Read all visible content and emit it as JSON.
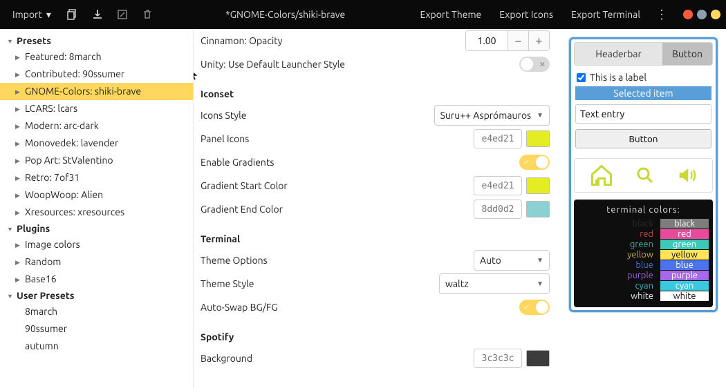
{
  "header": {
    "import_label": "Import",
    "title": "*GNOME-Colors/shiki-brave",
    "export_theme": "Export Theme",
    "export_icons": "Export Icons",
    "export_terminal": "Export Terminal",
    "dot_colors": [
      "#ff5a3c",
      "#8ca0b3",
      "#ffd75f"
    ]
  },
  "sidebar": {
    "groups": [
      {
        "title": "Presets",
        "items": [
          "Featured: 8march",
          "Contributed: 90ssumer",
          "GNOME-Colors: shiki-brave",
          "LCARS: lcars",
          "Modern: arc-dark",
          "Monovedek: lavender",
          "Pop Art: StValentino",
          "Retro: 7of31",
          "WoopWoop: Alien",
          "Xresources: xresources"
        ],
        "selected_index": 2
      },
      {
        "title": "Plugins",
        "items": [
          "Image colors",
          "Random",
          "Base16"
        ]
      },
      {
        "title": "User Presets",
        "items": [
          "8march",
          "90ssumer",
          "autumn"
        ],
        "leaf": true
      }
    ]
  },
  "main": {
    "cinnamon_opacity_label": "Cinnamon: Opacity",
    "cinnamon_opacity_value": "1.00",
    "unity_label": "Unity: Use Default Launcher Style",
    "iconset_h": "Iconset",
    "icons_style_label": "Icons Style",
    "icons_style_value": "Suru++ Asprómauros",
    "panel_icons_label": "Panel Icons",
    "panel_icons_hex": "e4ed21",
    "panel_icons_color": "#e4ed21",
    "enable_gradients_label": "Enable Gradients",
    "grad_start_label": "Gradient Start Color",
    "grad_start_hex": "e4ed21",
    "grad_start_color": "#e4ed21",
    "grad_end_label": "Gradient End Color",
    "grad_end_hex": "8dd0d2",
    "grad_end_color": "#8dd0d2",
    "terminal_h": "Terminal",
    "theme_options_label": "Theme Options",
    "theme_options_value": "Auto",
    "theme_style_label": "Theme Style",
    "theme_style_value": "waltz",
    "autoswap_label": "Auto-Swap BG/FG",
    "spotify_h": "Spotify",
    "bg_label": "Background",
    "bg_hex": "3c3c3c",
    "bg_color": "#3c3c3c"
  },
  "preview": {
    "headerbar_label": "Headerbar",
    "headerbar_button": "Button",
    "label_text": "This is a label",
    "selected_text": "Selected item",
    "entry_value": "Text entry",
    "button_label": "Button",
    "icon_color": "#c7d932",
    "term_title": "terminal colors:",
    "colors": [
      {
        "name": "black",
        "fg": "#2b2b2b",
        "bg": "#7d7d7d"
      },
      {
        "name": "red",
        "fg": "#b84a55",
        "bg": "#e84a9c"
      },
      {
        "name": "green",
        "fg": "#3fae9a",
        "bg": "#3cc9b7"
      },
      {
        "name": "yellow",
        "fg": "#c6a84a",
        "bg": "#ffe45a"
      },
      {
        "name": "blue",
        "fg": "#4a74c7",
        "bg": "#4b73f0"
      },
      {
        "name": "purple",
        "fg": "#9a63c7",
        "bg": "#a768ec"
      },
      {
        "name": "cyan",
        "fg": "#3fb4c7",
        "bg": "#3cc9dd"
      },
      {
        "name": "white",
        "fg": "#e6e6e6",
        "bg": "#ffffff"
      }
    ]
  }
}
